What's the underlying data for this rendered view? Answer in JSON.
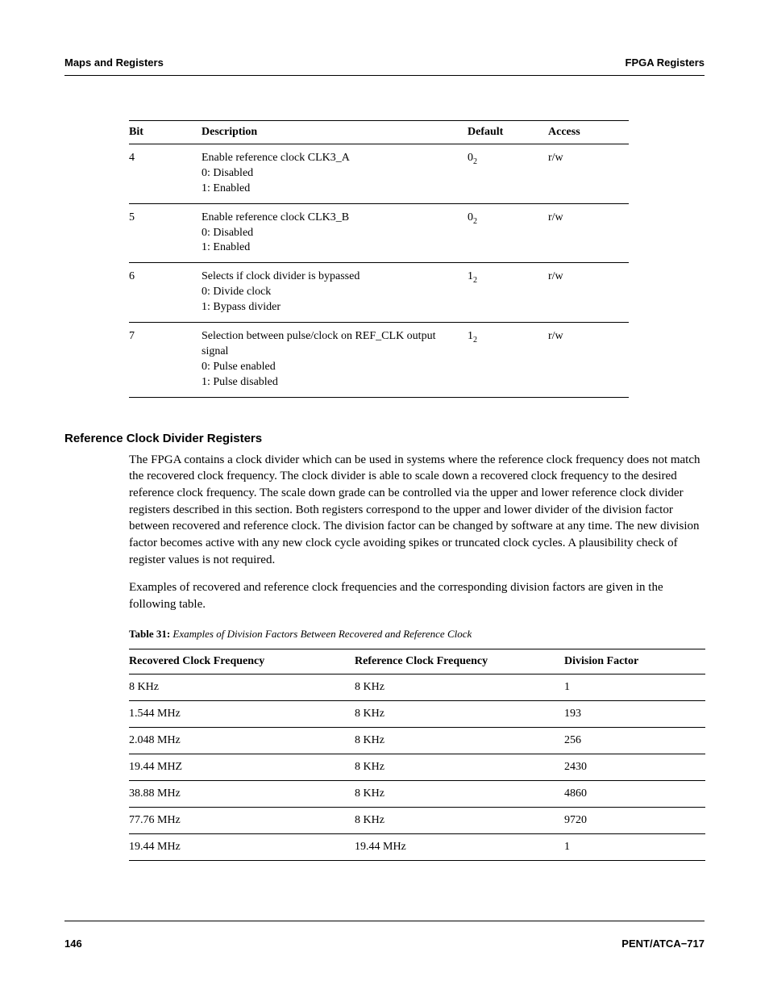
{
  "header": {
    "left": "Maps and Registers",
    "right": "FPGA Registers"
  },
  "bit_table": {
    "headers": {
      "bit": "Bit",
      "desc": "Description",
      "def": "Default",
      "acc": "Access"
    },
    "rows": [
      {
        "bit": "4",
        "desc": "Enable reference clock CLK3_A\n0: Disabled\n1: Enabled",
        "def_main": "0",
        "def_sub": "2",
        "acc": "r/w"
      },
      {
        "bit": "5",
        "desc": "Enable reference clock CLK3_B\n0: Disabled\n1: Enabled",
        "def_main": "0",
        "def_sub": "2",
        "acc": "r/w"
      },
      {
        "bit": "6",
        "desc": "Selects if clock divider is bypassed\n0: Divide clock\n1: Bypass divider",
        "def_main": "1",
        "def_sub": "2",
        "acc": "r/w"
      },
      {
        "bit": "7",
        "desc": "Selection between pulse/clock on REF_CLK output signal\n0: Pulse enabled\n1: Pulse disabled",
        "def_main": "1",
        "def_sub": "2",
        "acc": "r/w"
      }
    ]
  },
  "section_heading": "Reference Clock Divider Registers",
  "para1": "The FPGA contains a clock divider which can be used in systems where the reference clock frequency does not match the recovered clock frequency. The clock divider is able to scale down a recovered clock frequency to the desired reference clock frequency. The scale down grade can be controlled via the upper and lower reference clock divider registers described in this section. Both registers correspond to the upper and lower divider of the division factor between recovered and reference clock. The division factor can be changed by software at any time. The new division factor becomes active with any new clock cycle avoiding spikes or truncated clock cycles. A plausibility check of register values is not required.",
  "para2": "Examples of recovered and reference clock frequencies and the corresponding division factors are given in the following table.",
  "caption": {
    "label": "Table 31:",
    "text": " Examples of Division Factors Between Recovered and Reference Clock"
  },
  "freq_table": {
    "headers": {
      "rec": "Recovered Clock Frequency",
      "ref": "Reference Clock Frequency",
      "div": "Division Factor"
    },
    "rows": [
      {
        "rec": "8 KHz",
        "ref": "8 KHz",
        "div": "1"
      },
      {
        "rec": "1.544 MHz",
        "ref": "8 KHz",
        "div": "193"
      },
      {
        "rec": "2.048 MHz",
        "ref": "8 KHz",
        "div": "256"
      },
      {
        "rec": "19.44 MHZ",
        "ref": "8 KHz",
        "div": "2430"
      },
      {
        "rec": "38.88 MHz",
        "ref": "8 KHz",
        "div": "4860"
      },
      {
        "rec": "77.76 MHz",
        "ref": "8 KHz",
        "div": "9720"
      },
      {
        "rec": "19.44 MHz",
        "ref": "19.44 MHz",
        "div": "1"
      }
    ]
  },
  "footer": {
    "left": "146",
    "right": "PENT/ATCA−717"
  }
}
